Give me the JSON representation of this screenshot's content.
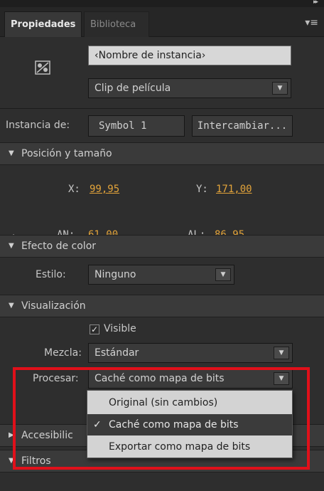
{
  "tabs": [
    {
      "label": "Propiedades"
    },
    {
      "label": "Biblioteca"
    }
  ],
  "instance": {
    "name_placeholder": "‹Nombre de instancia›",
    "type_value": "Clip de película",
    "instance_of_label": "Instancia de:",
    "symbol_value": "Symbol 1",
    "swap_button": "Intercambiar..."
  },
  "position": {
    "header": "Posición y tamaño",
    "x_label": "X:",
    "x_value": "99,95",
    "y_label": "Y:",
    "y_value": "171,00",
    "w_label": "AN:",
    "w_value": "61,00",
    "h_label": "AL:",
    "h_value": "86,95"
  },
  "color": {
    "header": "Efecto de color",
    "style_label": "Estilo:",
    "style_value": "Ninguno"
  },
  "display": {
    "header": "Visualización",
    "visible_label": "Visible",
    "visible_checked": true,
    "blend_label": "Mezcla:",
    "blend_value": "Estándar",
    "render_label": "Procesar:",
    "render_value": "Caché como mapa de bits",
    "render_options": [
      {
        "label": "Original (sin cambios)",
        "checked": false
      },
      {
        "label": "Caché como mapa de bits",
        "checked": true
      },
      {
        "label": "Exportar como mapa de bits",
        "checked": false
      }
    ]
  },
  "accessibility": {
    "header": "Accesibilic"
  },
  "filters": {
    "header": "Filtros"
  },
  "icons": {
    "collapse": "double-chevron-right-icon",
    "menu": "panel-menu-icon",
    "symbol": "movie-clip-icon",
    "link": "chain-link-icon",
    "expanded": "triangle-down-icon",
    "collapsed": "triangle-right-icon",
    "dropdown": "triangle-down-icon",
    "check": "checkmark-icon"
  },
  "colors": {
    "panel_bg": "#2e2e2e",
    "value_orange": "#e3a43a",
    "highlight_red": "#e0101a",
    "menu_bg": "#d3d3d3",
    "menu_hover": "#3b3b3b"
  }
}
